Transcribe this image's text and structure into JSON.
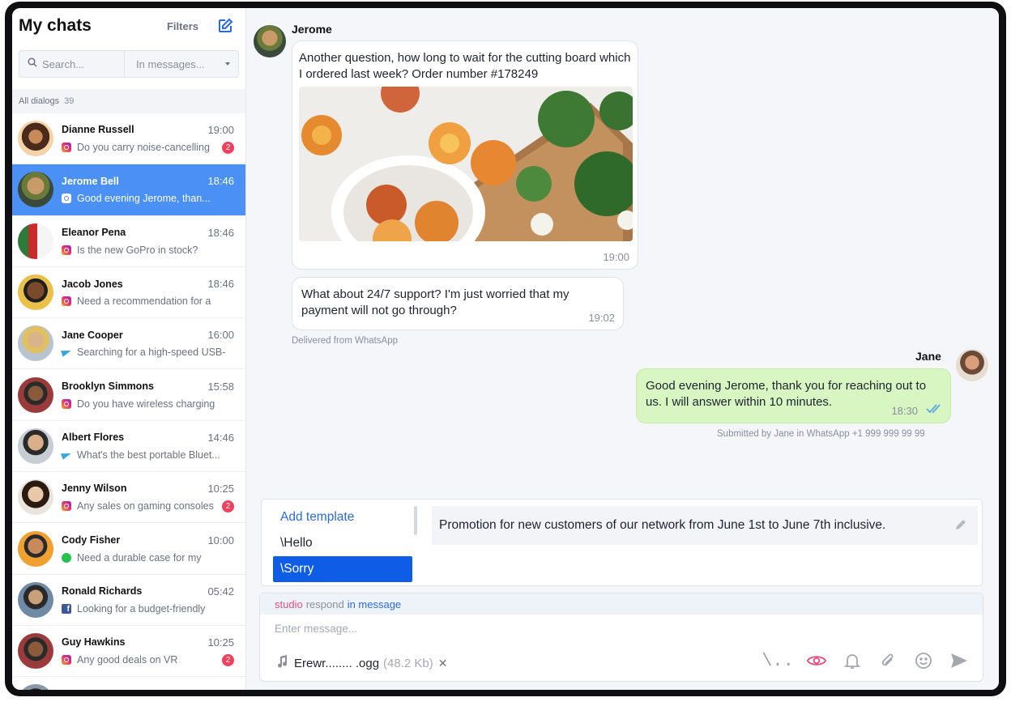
{
  "sidebar": {
    "title": "My chats",
    "filters_label": "Filters",
    "search_placeholder": "Search...",
    "scope_select": "In messages...",
    "dialogs_label": "All dialogs",
    "dialogs_count": "39",
    "chats": [
      {
        "name": "Dianne Russell",
        "time": "19:00",
        "preview": "Do you carry noise-cancelling",
        "channel": "instagram",
        "badge": "2"
      },
      {
        "name": "Jerome Bell",
        "time": "18:46",
        "preview": "Good evening Jerome, than...",
        "channel": "instagram",
        "active": true
      },
      {
        "name": "Eleanor Pena",
        "time": "18:46",
        "preview": "Is the new GoPro in stock?",
        "channel": "instagram"
      },
      {
        "name": "Jacob Jones",
        "time": "18:46",
        "preview": "Need a recommendation for a",
        "channel": "instagram"
      },
      {
        "name": "Jane Cooper",
        "time": "16:00",
        "preview": "Searching for a high-speed USB-",
        "channel": "telegram"
      },
      {
        "name": "Brooklyn Simmons",
        "time": "15:58",
        "preview": "Do you have wireless charging",
        "channel": "instagram"
      },
      {
        "name": "Albert Flores",
        "time": "14:46",
        "preview": "What's the best portable Bluet...",
        "channel": "telegram"
      },
      {
        "name": "Jenny Wilson",
        "time": "10:25",
        "preview": "Any sales on gaming consoles",
        "channel": "instagram",
        "badge": "2"
      },
      {
        "name": "Cody Fisher",
        "time": "10:00",
        "preview": "Need a durable case for my",
        "channel": "whatsapp"
      },
      {
        "name": "Ronald Richards",
        "time": "05:42",
        "preview": "Looking for a budget-friendly",
        "channel": "facebook"
      },
      {
        "name": "Guy Hawkins",
        "time": "10:25",
        "preview": "Any good deals on VR",
        "channel": "instagram",
        "badge": "2"
      }
    ]
  },
  "conversation": {
    "contact_name": "Jerome",
    "msg1_text": "Another question, how long to wait for the cutting board which I ordered last week?  Order number #178249",
    "msg1_time": "19:00",
    "msg2_text": "What about 24/7 support? I'm just worried that my payment will not go through?",
    "msg2_time": "19:02",
    "msg2_meta": "Delivered from WhatsApp",
    "agent_name": "Jane",
    "reply_text": "Good evening Jerome, thank you for reaching out to us. I will answer within 10 minutes.",
    "reply_time": "18:30",
    "reply_meta": "Submitted by Jane in WhatsApp +1 999 999 99 99"
  },
  "templates": {
    "add_label": "Add template",
    "items": [
      "\\Hello",
      "\\Sorry"
    ],
    "preview_text": "Promotion for new customers of our network from June 1st to June 7th inclusive."
  },
  "composer": {
    "mode_studio": "studio",
    "mode_respond": "respond",
    "mode_message": "in message",
    "placeholder": "Enter message...",
    "attachment_name": "Erewr........ .ogg",
    "attachment_size": "(48.2 Kb)",
    "slash_label": "\\..",
    "colors": {
      "accent": "#4a90f5",
      "eye": "#e4507a",
      "selected_template": "#0f5de6"
    }
  },
  "icons": [
    "compose-icon",
    "search-icon",
    "chevron-down-icon",
    "instagram-icon",
    "telegram-icon",
    "whatsapp-icon",
    "facebook-icon",
    "edit-pencil-icon",
    "music-note-icon",
    "close-icon",
    "eye-icon",
    "bell-icon",
    "paperclip-icon",
    "emoji-icon",
    "send-icon",
    "double-check-icon"
  ]
}
